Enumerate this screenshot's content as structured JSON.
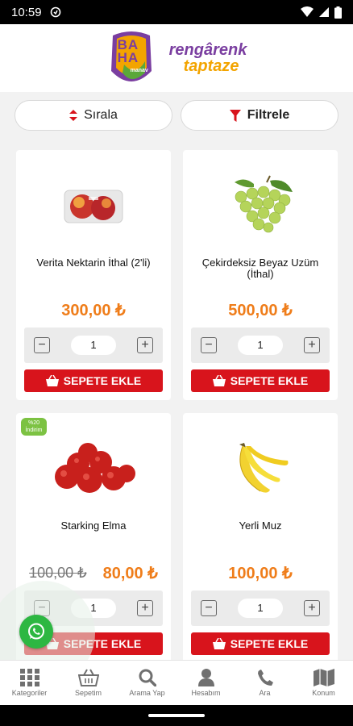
{
  "status": {
    "time": "10:59"
  },
  "header": {
    "logo_letters": [
      "BA",
      "HA"
    ],
    "logo_sub": "manav",
    "slogan_line1": "rengârenk",
    "slogan_line2": "taptaze"
  },
  "toolbar": {
    "sort_label": "Sırala",
    "filter_label": "Filtrele"
  },
  "products": [
    {
      "name": "Verita Nektarin İthal (2'li)",
      "price": "300,00 ₺",
      "old_price": "",
      "qty": "1",
      "add_label": "SEPETE EKLE",
      "badge": ""
    },
    {
      "name": "Çekirdeksiz Beyaz Uzüm (İthal)",
      "price": "500,00 ₺",
      "old_price": "",
      "qty": "1",
      "add_label": "SEPETE EKLE",
      "badge": ""
    },
    {
      "name": "Starking Elma",
      "price": "80,00 ₺",
      "old_price": "100,00 ₺",
      "qty": "1",
      "add_label": "SEPETE EKLE",
      "badge": "%20 İndirim"
    },
    {
      "name": "Yerli Muz",
      "price": "100,00 ₺",
      "old_price": "",
      "qty": "1",
      "add_label": "SEPETE EKLE",
      "badge": ""
    }
  ],
  "bottom_nav": [
    {
      "label": "Kategoriler",
      "icon": "grid-icon"
    },
    {
      "label": "Sepetim",
      "icon": "basket-icon"
    },
    {
      "label": "Arama Yap",
      "icon": "search-icon"
    },
    {
      "label": "Hesabım",
      "icon": "user-icon"
    },
    {
      "label": "Ara",
      "icon": "phone-icon"
    },
    {
      "label": "Konum",
      "icon": "map-icon"
    }
  ],
  "colors": {
    "accent": "#d8141c",
    "price": "#ef7d1a",
    "brand_purple": "#7a3ea0",
    "brand_yellow": "#f3a400",
    "whatsapp": "#2db742"
  }
}
